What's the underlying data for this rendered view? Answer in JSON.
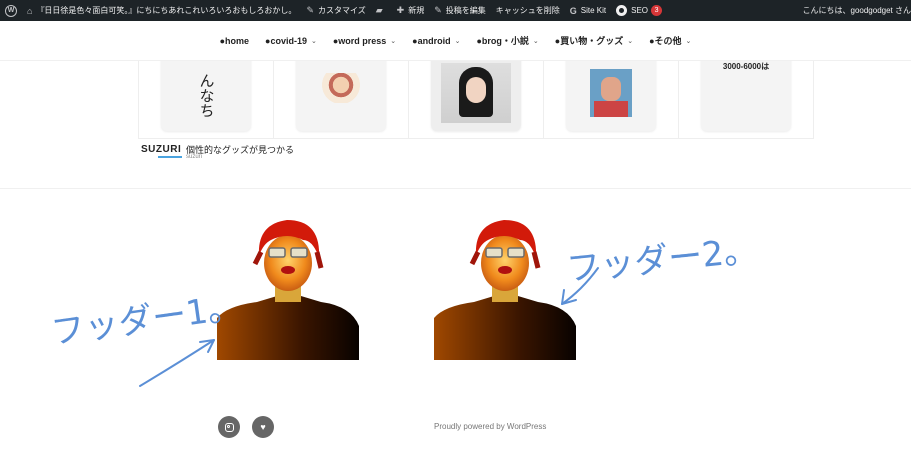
{
  "adminbar": {
    "site_title": "『日日徐是色々面白可笑。』にちにちあれこれいろいろおもしろおかし。",
    "customize": "カスタマイズ",
    "new": "新規",
    "edit_post": "投稿を編集",
    "clear_cache": "キャッシュを削除",
    "site_kit": "Site Kit",
    "seo": "SEO",
    "seo_count": "3",
    "greeting": "こんにちは、goodgodget さん"
  },
  "nav": {
    "items": [
      {
        "label": "●home",
        "has_sub": false
      },
      {
        "label": "●covid-19",
        "has_sub": true
      },
      {
        "label": "●word press",
        "has_sub": true
      },
      {
        "label": "●android",
        "has_sub": true
      },
      {
        "label": "●brog・小説",
        "has_sub": true
      },
      {
        "label": "●買い物・グッズ",
        "has_sub": true
      },
      {
        "label": "●その他",
        "has_sub": true
      }
    ],
    "chevron": "⌄"
  },
  "suzuri": {
    "brand": "SUZURI",
    "tagline": "個性的なグッズが見つかる",
    "sub": "suzuri",
    "shirt_prints": [
      "んなち",
      "",
      "",
      "",
      "3000-6000は"
    ]
  },
  "footer": {
    "handwriting_left": "フッダー1。",
    "handwriting_right": "フッダー2。",
    "powered": "Proudly powered by WordPress"
  },
  "colors": {
    "adminbar_bg": "#1d2327",
    "annotation_blue": "#5b8fd6",
    "social_bg": "#666666",
    "seo_badge": "#d63638"
  }
}
